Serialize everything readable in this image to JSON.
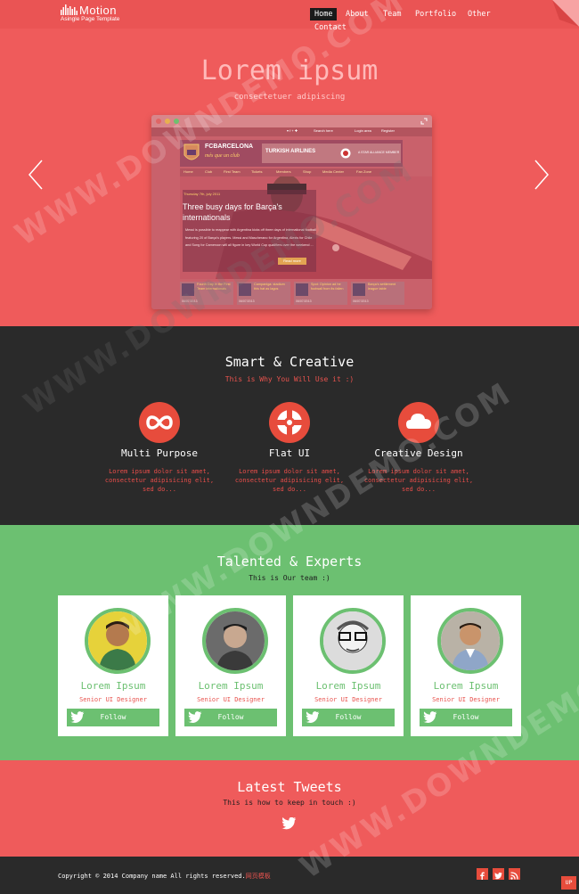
{
  "header": {
    "logo_name": "Motion",
    "logo_tagline": "Asingle Page Template",
    "nav": [
      "Home",
      "About",
      "Team",
      "Portfolio",
      "Other",
      "Contact"
    ],
    "active_nav": "Home"
  },
  "hero": {
    "title": "Lorem ipsum",
    "subtitle": "consectetuer adipiscing",
    "prev_icon": "chevron-left-icon",
    "next_icon": "chevron-right-icon",
    "screenshot": {
      "search": "Search here",
      "login": "Login area",
      "register": "Register",
      "brand": "FCBARCELONA",
      "motto": "més que un club",
      "airline": "TURKISH AIRLINES",
      "airline_note": "A STAR ALLIANCE MEMBER",
      "menu": [
        "Home",
        "Club",
        "First Team",
        "Tickets",
        "Members",
        "Shop",
        "Media Center",
        "Fan Zone"
      ],
      "date": "Thursday 7th, july 2011",
      "headline": "Three busy days for Barça's internationals",
      "body": "Messi is possible to reappear with Argentina kicks off three days of international football featuring 20 of Barça's players. Messi and Mascherano for Argentina, Alexis for Chile and Song for Cameroon will all figure in key World Cup qualifiers over the weekend ...",
      "read_more": "Read more",
      "thumbs": [
        {
          "text": "Fourth Day in the First Team internationals",
          "meta": "06/07/2013"
        },
        {
          "text": "Campaniga: stadium this hat as lagos",
          "meta": "06/07/2013"
        },
        {
          "text": "Spot: Opinion ad he footwall from its fallen",
          "meta": "06/07/2013"
        },
        {
          "text": "Barça's settlement league table",
          "meta": "06/07/2013"
        }
      ]
    }
  },
  "smart": {
    "title": "Smart & Creative",
    "subtitle": "This is Why You Will Use it :)",
    "features": [
      {
        "icon": "infinity-icon",
        "title": "Multi Purpose",
        "body": "Lorem ipsum dolor sit amet, consectetur adipisicing elit, sed do..."
      },
      {
        "icon": "lifebuoy-icon",
        "title": "Flat UI",
        "body": "Lorem ipsum dolor sit amet, consectetur adipisicing elit, sed do..."
      },
      {
        "icon": "cloud-icon",
        "title": "Creative Design",
        "body": "Lorem ipsum dolor sit amet, consectetur adipisicing elit, sed do..."
      }
    ]
  },
  "team": {
    "title": "Talented & Experts",
    "subtitle": "This is Our team :)",
    "members": [
      {
        "name": "Lorem Ipsum",
        "role": "Senior UI Designer",
        "follow": "Follow"
      },
      {
        "name": "Lorem Ipsum",
        "role": "Senior UI Designer",
        "follow": "Follow"
      },
      {
        "name": "Lorem Ipsum",
        "role": "Senior UI Designer",
        "follow": "Follow"
      },
      {
        "name": "Lorem Ipsum",
        "role": "Senior UI Designer",
        "follow": "Follow"
      }
    ]
  },
  "tweets": {
    "title": "Latest Tweets",
    "subtitle": "This is how to keep in touch :)",
    "icon": "twitter-icon"
  },
  "footer": {
    "copyright": "Copyright © 2014 Company name All rights reserved.",
    "copyright_link": "网页模板",
    "social": [
      "facebook-icon",
      "twitter-icon",
      "rss-icon"
    ],
    "up_label": "UP"
  },
  "watermark": "WWW.DOWNDEMO.COM",
  "colors": {
    "red": "#ef5b5b",
    "dark": "#2a2a2a",
    "green": "#6cc071",
    "accent": "#e74c3c"
  }
}
